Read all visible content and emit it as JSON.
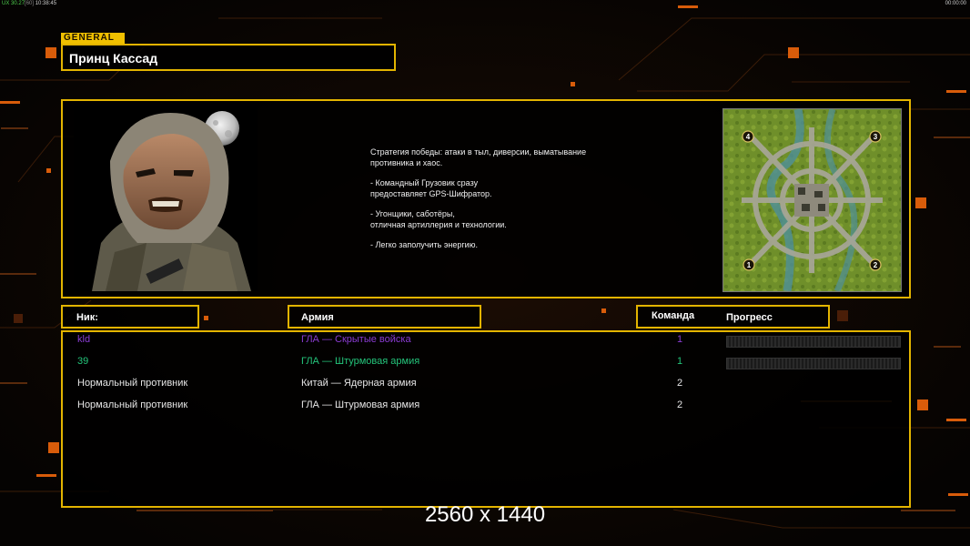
{
  "topbar": {
    "fps_label": "UX",
    "fps_value": "30.27",
    "fps_cap": "[60]",
    "time_left": "10:38:45",
    "time_right": "00:00:00"
  },
  "general": {
    "tag": "GENERAL",
    "name": "Принц Кассад"
  },
  "description": [
    "Стратегия победы: атаки в тыл, диверсии, выматывание\n противника и хаос.",
    "- Командный Грузовик сразу\nпредоставляет GPS-Шифратор.",
    "- Угонщики, саботёры,\nотличная артиллерия и технологии.",
    "- Легко заполучить энергию."
  ],
  "minimap": {
    "start_positions": [
      "4",
      "3",
      "1",
      "2"
    ]
  },
  "player_list": {
    "header_nick": "Ник:",
    "header_army": "Армия",
    "header_team": "Команда",
    "header_progress": "Прогресс",
    "players": [
      {
        "nick": "kld",
        "army": "ГЛА — Скрытые войска",
        "team": "1",
        "color": "#8a3cd2",
        "has_progress": true
      },
      {
        "nick": "39",
        "army": "ГЛА — Штурмовая армия",
        "team": "1",
        "color": "#24c47a",
        "has_progress": true
      },
      {
        "nick": "Нормальный противник",
        "army": "Китай — Ядерная армия",
        "team": "2",
        "color": "#e6e6e6",
        "has_progress": false
      },
      {
        "nick": "Нормальный противник",
        "army": "ГЛА — Штурмовая армия",
        "team": "2",
        "color": "#e6e6e6",
        "has_progress": false
      }
    ]
  },
  "resolution_text": "2560 x 1440",
  "colors": {
    "accent": "#e3b400",
    "orange_light": "#ff7a10"
  }
}
